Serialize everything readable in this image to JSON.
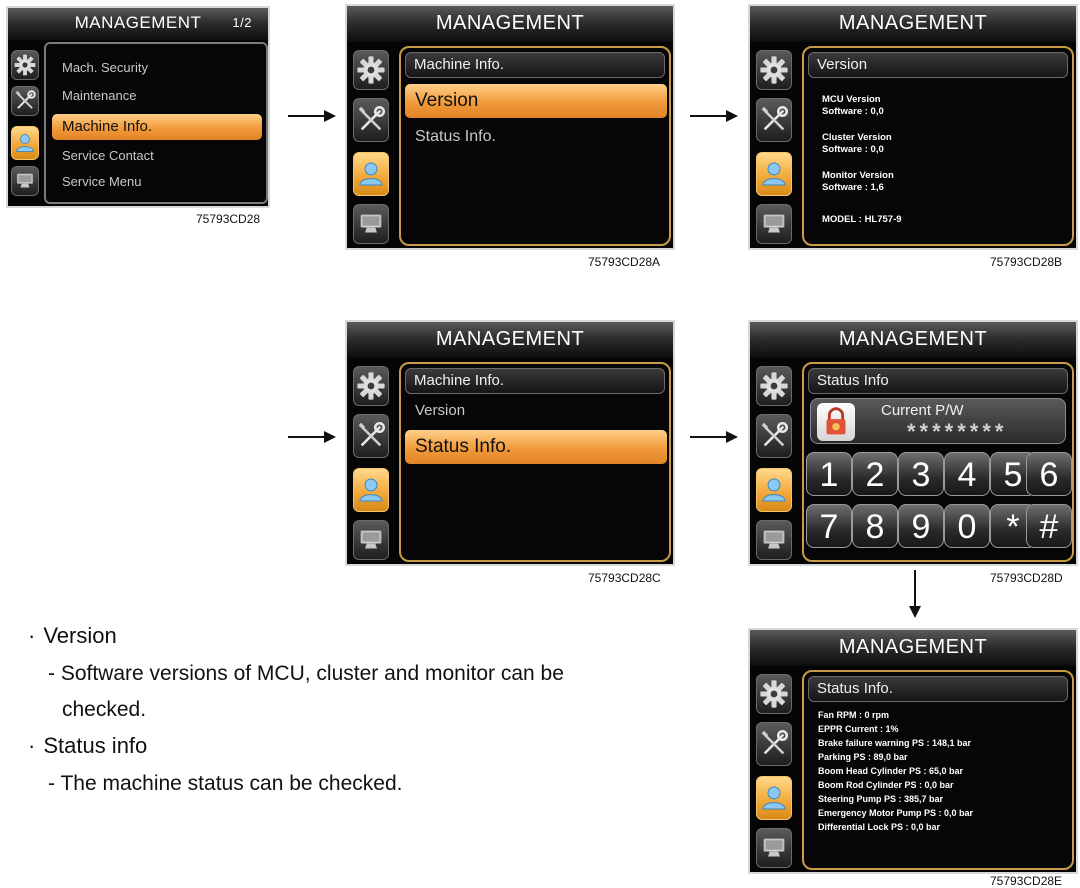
{
  "screens": {
    "s1": {
      "title": "MANAGEMENT",
      "page": "1/2",
      "menu": [
        "Mach. Security",
        "Maintenance",
        "Machine Info.",
        "Service Contact",
        "Service Menu"
      ],
      "caption": "75793CD28"
    },
    "s2": {
      "title": "MANAGEMENT",
      "header": "Machine Info.",
      "menu": [
        "Version",
        "Status Info."
      ],
      "caption": "75793CD28A"
    },
    "s3": {
      "title": "MANAGEMENT",
      "header": "Version",
      "lines": [
        "MCU Version",
        "Software : 0,0",
        "Cluster Version",
        "Software : 0,0",
        "Monitor Version",
        "Software : 1,6",
        "MODEL : HL757-9"
      ],
      "caption": "75793CD28B"
    },
    "s4": {
      "title": "MANAGEMENT",
      "header": "Machine Info.",
      "menu": [
        "Version",
        "Status Info."
      ],
      "caption": "75793CD28C"
    },
    "s5": {
      "title": "MANAGEMENT",
      "header": "Status Info",
      "pw_label": "Current P/W",
      "pw_mask": "********",
      "keys": [
        "1",
        "2",
        "3",
        "4",
        "5",
        "6",
        "7",
        "8",
        "9",
        "0",
        "*",
        "#"
      ],
      "caption": "75793CD28D"
    },
    "s6": {
      "title": "MANAGEMENT",
      "header": "Status Info.",
      "lines": [
        "Fan RPM : 0 rpm",
        "EPPR Current : 1%",
        "Brake failure warning PS : 148,1 bar",
        "Parking PS : 89,0 bar",
        "Boom Head Cylinder PS : 65,0 bar",
        "Boom Rod Cylinder PS : 0,0 bar",
        "Steering Pump PS : 385,7 bar",
        "Emergency Motor Pump PS : 0,0 bar",
        "Differential Lock PS : 0,0 bar"
      ],
      "caption": "75793CD28E"
    }
  },
  "sidebar_icons": [
    "gear-icon",
    "wrench-screwdriver-icon",
    "user-icon",
    "monitor-icon"
  ],
  "colors": {
    "accent": "#f19a3a",
    "frame": "#c99a47",
    "screen_bg": "#050505"
  },
  "doc": {
    "version_title": "Version",
    "version_desc_1": "- Software versions of MCU, cluster and monitor can be",
    "version_desc_2": "checked.",
    "status_title": "Status info",
    "status_desc": "- The machine status can be checked.",
    "bullet": "·"
  }
}
